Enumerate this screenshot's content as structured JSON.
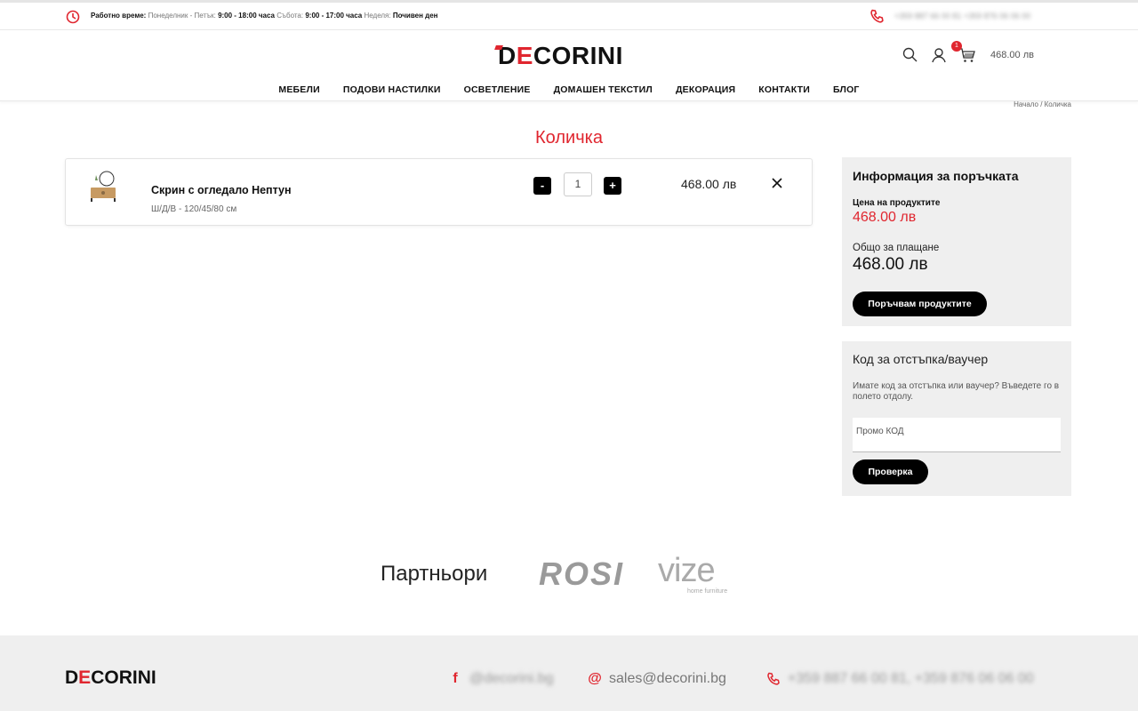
{
  "topbar": {
    "hours_label": "Работно време:",
    "weekdays_label": "Понеделник - Петък:",
    "weekdays_hours": "9:00 - 18:00 часа",
    "saturday_label": "Събота:",
    "saturday_hours": "9:00 - 17:00 часа",
    "sunday_label": "Неделя:",
    "sunday_hours": "Почивен ден",
    "phones": "+359 887 66 00 81   +359 876 06 06 00"
  },
  "header": {
    "logo_d": "D",
    "logo_e": "E",
    "logo_rest": "CORINI",
    "cart_count": "1",
    "cart_total": "468.00 лв"
  },
  "nav": [
    "МЕБЕЛИ",
    "ПОДОВИ НАСТИЛКИ",
    "ОСВЕТЛЕНИЕ",
    "ДОМАШЕН ТЕКСТИЛ",
    "ДЕКОРАЦИЯ",
    "КОНТАКТИ",
    "БЛОГ"
  ],
  "breadcrumb": "Начало / Количка",
  "page_title": "Количка",
  "cart_item": {
    "name": "Скрин с огледало Нептун",
    "dimensions": "Ш/Д/В - 120/45/80 см",
    "minus": "-",
    "quantity": "1",
    "plus": "+",
    "price": "468.00 лв"
  },
  "summary": {
    "title": "Информация за поръчката",
    "products_label": "Цена на продуктите",
    "products_price": "468.00 лв",
    "total_label": "Общо за плащане",
    "total_price": "468.00 лв",
    "order_button": "Поръчвам продуктите"
  },
  "voucher": {
    "title": "Код за отстъпка/ваучер",
    "description": "Имате код за отстъпка или ваучер? Въведете го в полето отдолу.",
    "placeholder": "Промо КОД",
    "button": "Проверка"
  },
  "partners": {
    "title": "Партньори",
    "rosi": "ROSI",
    "vize": "vize",
    "vize_sub": "home furniture"
  },
  "footer": {
    "logo_d": "D",
    "logo_e": "E",
    "logo_rest": "CORINI",
    "facebook": "@decorini.bg",
    "email": "sales@decorini.bg",
    "phones": "+359 887 66 00 81, +359 876 06 06 00"
  },
  "colors": {
    "accent": "#e0262f",
    "panel": "#efefef"
  }
}
